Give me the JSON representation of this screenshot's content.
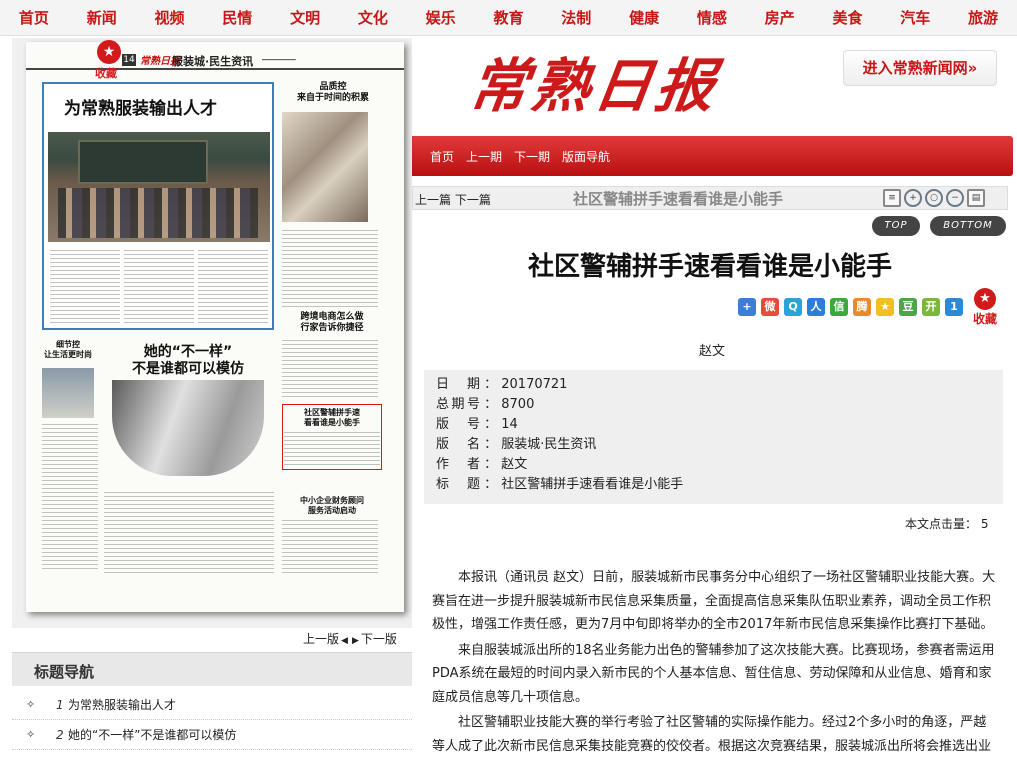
{
  "top_nav": [
    "首页",
    "新闻",
    "视频",
    "民情",
    "文明",
    "文化",
    "娱乐",
    "教育",
    "法制",
    "健康",
    "情感",
    "房产",
    "美食",
    "汽车",
    "旅游"
  ],
  "header": {
    "logo_text": "常熟日报",
    "enter_button": "进入常熟新闻网»"
  },
  "sub_nav": [
    "首页",
    "上一期",
    "下一期",
    "版面导航"
  ],
  "page_image": {
    "favorite_label": "收藏",
    "page_no": "14",
    "paper_name": "常熟日报",
    "section": "服装城·民生资讯",
    "lead_headline": "为常熟服装输出人才",
    "right_headline_1": "品质控\n来自于时间的积累",
    "right_headline_2": "跨境电商怎么做\n行家告诉你捷径",
    "left_small_headline": "细节控\n让生活更时尚",
    "center_headline": "她的“不一样”\n不是谁都可以模仿",
    "highlight_headline": "社区警辅拼手速\n看看谁是小能手",
    "bottom_right_headline": "中小企业财务顾问\n服务活动启动"
  },
  "page_nav": {
    "prev": "上一版",
    "next": "下一版"
  },
  "title_nav": {
    "heading": "标题导航",
    "items": [
      {
        "num": "1",
        "title": "为常熟服装输出人才"
      },
      {
        "num": "2",
        "title": "她的“不一样”不是谁都可以模仿"
      }
    ]
  },
  "article_bar": {
    "prev_next": "上一篇 下一篇",
    "title": "社区警辅拼手速看看谁是小能手"
  },
  "top_button": "TOP",
  "bottom_button": "BOTTOM",
  "article": {
    "title": "社区警辅拼手速看看谁是小能手",
    "author": "赵文",
    "favorite_label": "收藏",
    "meta": [
      {
        "key": "日期",
        "value": "20170721"
      },
      {
        "key": "总期号",
        "value": "8700"
      },
      {
        "key": "版号",
        "value": "14"
      },
      {
        "key": "版名",
        "value": "服装城·民生资讯"
      },
      {
        "key": "作者",
        "value": "赵文"
      },
      {
        "key": "标题",
        "value": "社区警辅拼手速看看谁是小能手"
      }
    ],
    "hits_label": "本文点击量：",
    "hits_value": "5",
    "paragraphs": [
      "本报讯（通讯员 赵文）日前，服装城新市民事务分中心组织了一场社区警辅职业技能大赛。大赛旨在进一步提升服装城新市民信息采集质量，全面提高信息采集队伍职业素养，调动全员工作积极性，增强工作责任感，更为7月中旬即将举办的全市2017年新市民信息采集操作比赛打下基础。",
      "来自服装城派出所的18名业务能力出色的警辅参加了这次技能大赛。比赛现场，参赛者需运用PDA系统在最短的时间内录入新市民的个人基本信息、暂住信息、劳动保障和从业信息、婚育和家庭成员信息等几十项信息。",
      "社区警辅职业技能大赛的举行考验了社区警辅的实际操作能力。经过2个多小时的角逐，严越等人成了此次新市民信息采集技能竞赛的佼佼者。根据这次竞赛结果，服装城派出所将会推选出业务能手参加全"
    ]
  },
  "colors": {
    "brand_red": "#c81616",
    "meta_bg": "#efefef"
  }
}
